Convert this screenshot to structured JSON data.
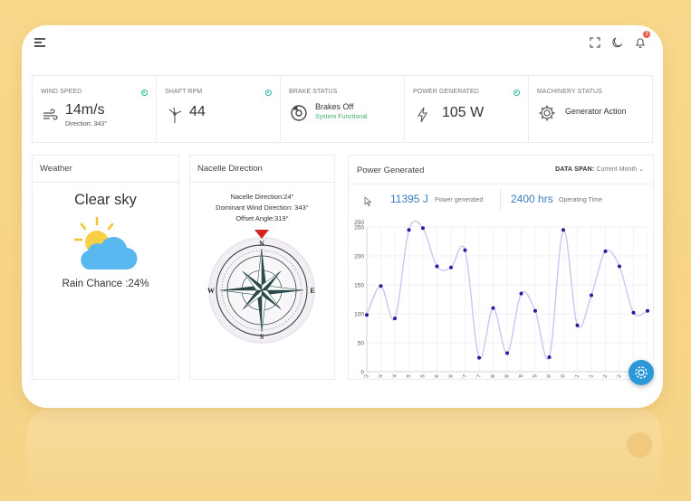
{
  "stats": {
    "wind": {
      "label": "WIND SPEED",
      "value": "14m/s",
      "sub": "Direction: 343°"
    },
    "rpm": {
      "label": "SHAFT RPM",
      "value": "44"
    },
    "brake": {
      "label": "BRAKE STATUS",
      "title": "Brakes Off",
      "sub": "System Functional"
    },
    "power": {
      "label": "POWER GENERATED",
      "value": "105 W"
    },
    "machinery": {
      "label": "MACHINERY STATUS",
      "title": "Generator Action"
    }
  },
  "notification_count": "3",
  "weather": {
    "header": "Weather",
    "condition": "Clear sky",
    "rain": "Rain Chance :24%"
  },
  "nacelle": {
    "header": "Nacelle Direction",
    "lines": [
      "Nacelle Direction:24°",
      "Dominant Wind Direction: 343°",
      "Offset Angle:319°"
    ],
    "compass": {
      "n": "N",
      "s": "S",
      "e": "E",
      "w": "W"
    }
  },
  "power_panel": {
    "header": "Power Generated",
    "span_label": "DATA SPAN:",
    "span_value": "Current Month",
    "kpi1_value": "11395 J",
    "kpi1_label": "Power generated",
    "kpi2_value": "2400 hrs",
    "kpi2_label": "Operating Time"
  },
  "chart_data": {
    "type": "line",
    "yticks": [
      "0",
      "50",
      "100",
      "150",
      "200",
      "250",
      "250"
    ],
    "ylim": [
      0,
      250
    ],
    "categories": [
      "9-16:43",
      "9-16:44",
      "9-16:44",
      "9-16:45",
      "9-16:45",
      "9-16:46",
      "9-16:46",
      "9-16:47",
      "9-16:47",
      "9-16:48",
      "9-16:48",
      "9-16:49",
      "9-16:49",
      "9-16:50",
      "9-16:50",
      "9-16:51",
      "9-16:51",
      "9-16:52",
      "9-16:52",
      "9-16:53",
      "9-16:53"
    ],
    "values": [
      98,
      148,
      92,
      245,
      248,
      182,
      180,
      210,
      24,
      110,
      32,
      135,
      105,
      25,
      245,
      80,
      132,
      208,
      182,
      102,
      105
    ],
    "colors": {
      "line": "#c9c7ee",
      "point": "#1f1fa0"
    }
  }
}
